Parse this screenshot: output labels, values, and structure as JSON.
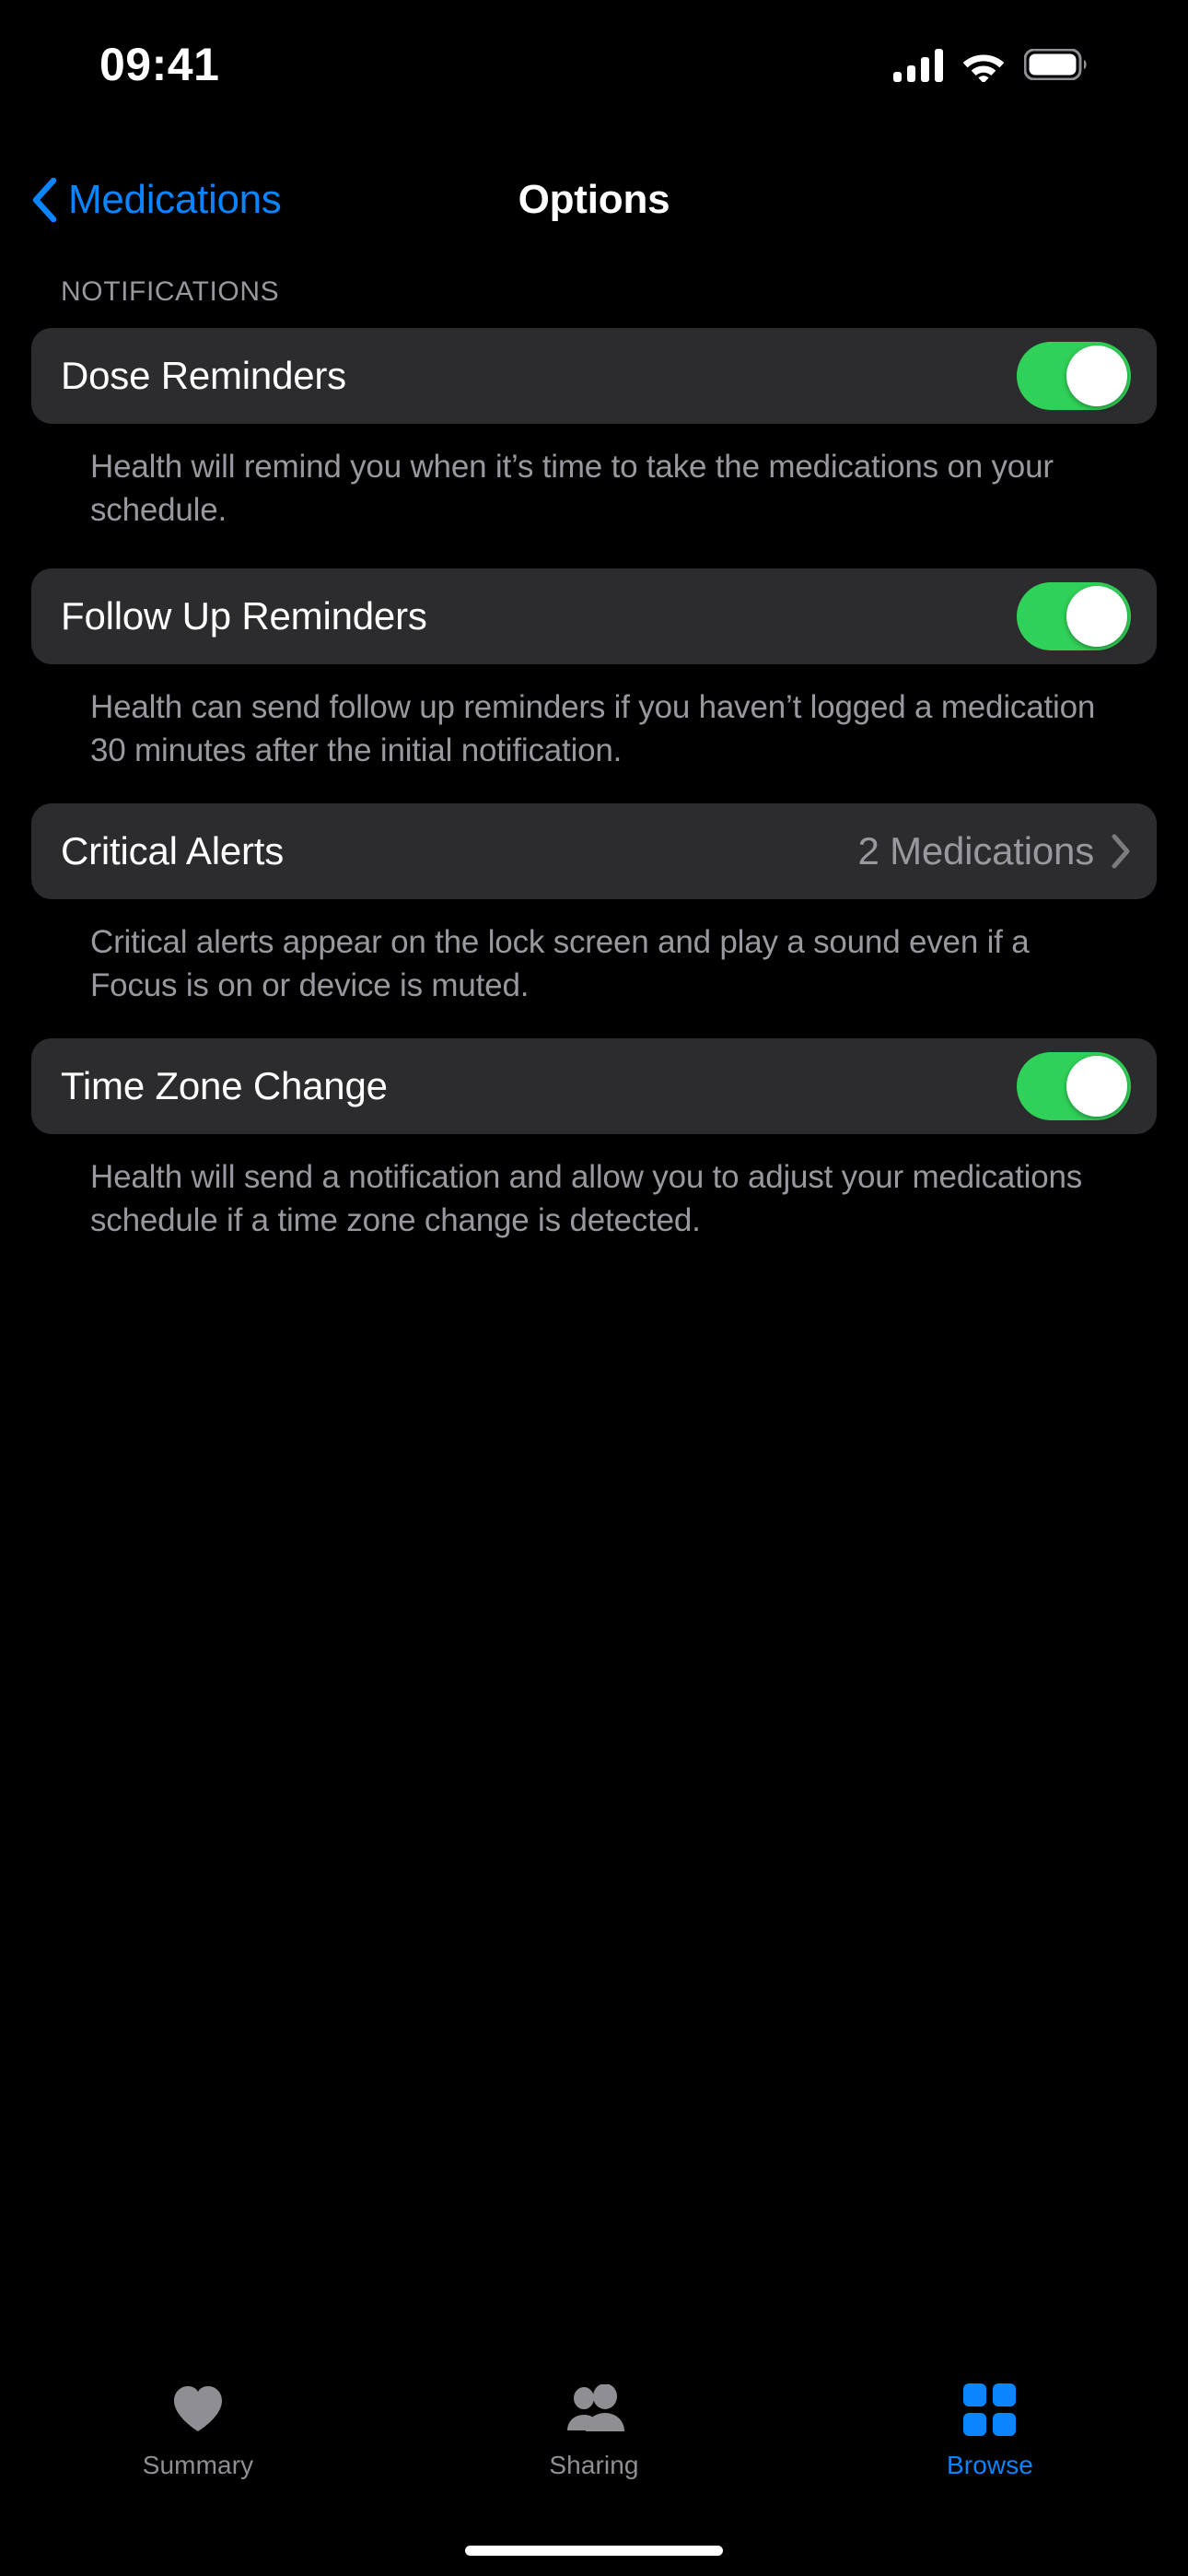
{
  "status_bar": {
    "time": "09:41",
    "cellular_icon": "cellular-signal-icon",
    "wifi_icon": "wifi-icon",
    "battery_icon": "battery-full-icon"
  },
  "nav_bar": {
    "back_icon": "chevron-left-icon",
    "back_label": "Medications",
    "title": "Options"
  },
  "sections": [
    {
      "header": "NOTIFICATIONS",
      "rows": [
        {
          "label": "Dose Reminders",
          "control": "toggle",
          "toggle_on": true,
          "footnote": "Health will remind you when it’s time to take the medications on your schedule."
        },
        {
          "label": "Follow Up Reminders",
          "control": "toggle",
          "toggle_on": true,
          "footnote": "Health can send follow up reminders if you haven’t logged a medication 30 minutes after the initial notification."
        },
        {
          "label": "Critical Alerts",
          "control": "disclosure",
          "value": "2 Medications",
          "chevron_icon": "chevron-right-icon",
          "footnote": "Critical alerts appear on the lock screen and play a sound even if a Focus is on or device is muted."
        },
        {
          "label": "Time Zone Change",
          "control": "toggle",
          "toggle_on": true,
          "footnote": "Health will send a notification and allow you to adjust your medications schedule if a time zone change is detected."
        }
      ]
    }
  ],
  "tab_bar": {
    "tabs": [
      {
        "label": "Summary",
        "icon": "heart-icon",
        "active": false
      },
      {
        "label": "Sharing",
        "icon": "two-people-icon",
        "active": false
      },
      {
        "label": "Browse",
        "icon": "grid-icon",
        "active": true
      }
    ]
  },
  "colors": {
    "accent_blue": "#0A84FF",
    "toggle_green": "#30D158",
    "card_background": "#2C2C2E",
    "secondary_text": "#98989E",
    "page_background": "#000000"
  }
}
